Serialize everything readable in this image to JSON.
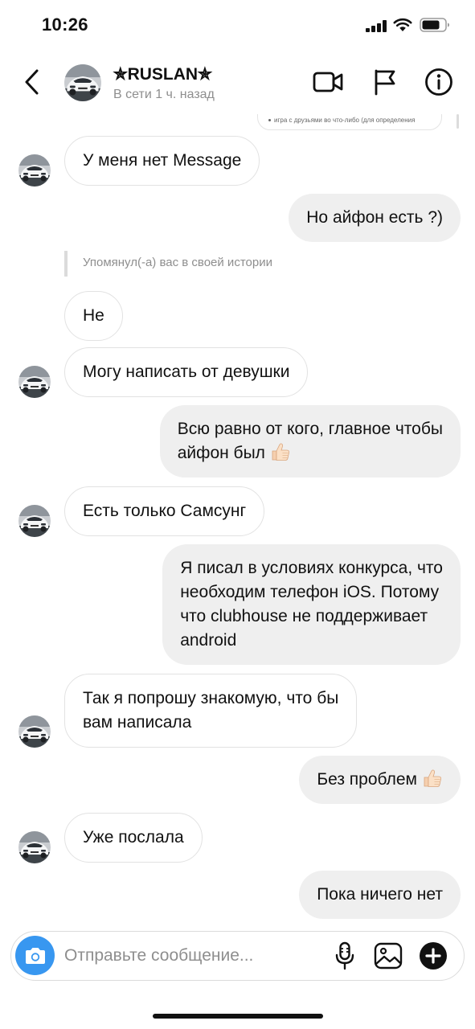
{
  "status_bar": {
    "time": "10:26",
    "icons": [
      "signal-icon",
      "wifi-icon",
      "battery-icon"
    ]
  },
  "header": {
    "name": "✯RUSLAN✯",
    "status": "В сети 1 ч. назад",
    "icons": [
      "back-icon",
      "video-call-icon",
      "flag-icon",
      "info-icon"
    ]
  },
  "story_card": {
    "text": "игра с друзьями во что-либо (для определения"
  },
  "messages": [
    {
      "side": "in",
      "text": "У меня нет Message",
      "avatar": true
    },
    {
      "side": "out",
      "text": "Но айфон есть ?)"
    },
    {
      "side": "system",
      "text": "Упомянул(-а) вас в своей истории"
    },
    {
      "side": "in",
      "text": "Не",
      "avatar": false
    },
    {
      "side": "in",
      "text": "Могу написать от девушки",
      "avatar": true
    },
    {
      "side": "out",
      "text_lines": [
        "Всю равно от кого, главное чтобы",
        "айфон был"
      ],
      "emoji": "thumbs-up-icon"
    },
    {
      "side": "in",
      "text": "Есть только Самсунг",
      "avatar": true
    },
    {
      "side": "out",
      "text_lines": [
        "Я писал в условиях конкурса, что",
        "необходим телефон iOS. Потому",
        "что clubhouse не поддерживает",
        "android"
      ]
    },
    {
      "side": "in",
      "text_lines": [
        "Так я попрошу знакомую, что бы",
        "вам написала"
      ],
      "avatar": true
    },
    {
      "side": "out",
      "text": "Без проблем",
      "emoji": "thumbs-up-icon"
    },
    {
      "side": "in",
      "text": "Уже послала",
      "avatar": true
    },
    {
      "side": "out",
      "text": "Пока ничего нет"
    }
  ],
  "composer": {
    "placeholder": "Отправьте сообщение...",
    "icons": [
      "camera-icon",
      "microphone-icon",
      "gallery-icon",
      "add-icon"
    ]
  },
  "colors": {
    "accent": "#3897f0",
    "incoming_border": "#e2e2e2",
    "outgoing_bg": "#efefef",
    "muted_text": "#8e8e8e"
  }
}
